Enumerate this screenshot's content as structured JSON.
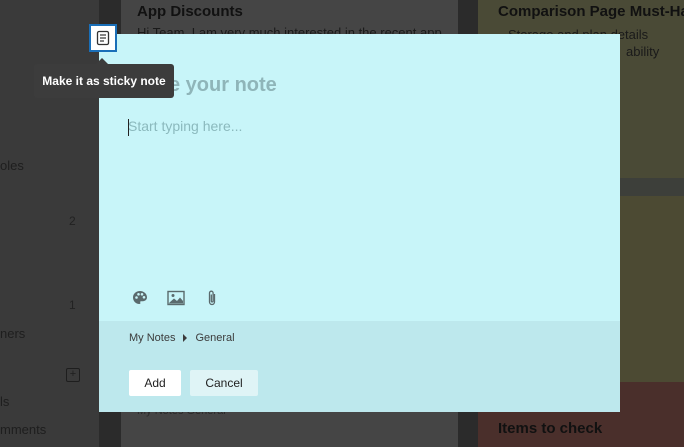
{
  "background": {
    "sidebar_rows": [
      "oles",
      "ners",
      "ls",
      "mments"
    ],
    "sidebar_counts": [
      "2",
      "1"
    ],
    "sidebar_add": "+",
    "cards": {
      "mid_title": "App Discounts",
      "mid_text": "Hi Team, I am very much interested in the recent app",
      "right_title": "Comparison Page Must-Have",
      "right_line1": "- Storage and plan details",
      "right_line2": "ability",
      "bottom_right_title": "Items to check",
      "bottom_breadcrumb": "My Notes    General"
    }
  },
  "tooltip": {
    "text": "Make it as sticky note"
  },
  "modal": {
    "title": "Title your note",
    "visible_title_fragment": "e your note",
    "note_placeholder": "Start typing here...",
    "toolbar": {
      "icons": [
        "palette-icon",
        "image-icon",
        "paperclip-icon"
      ]
    },
    "breadcrumb": {
      "notebook": "My Notes",
      "section": "General"
    },
    "buttons": {
      "add": "Add",
      "cancel": "Cancel"
    }
  }
}
